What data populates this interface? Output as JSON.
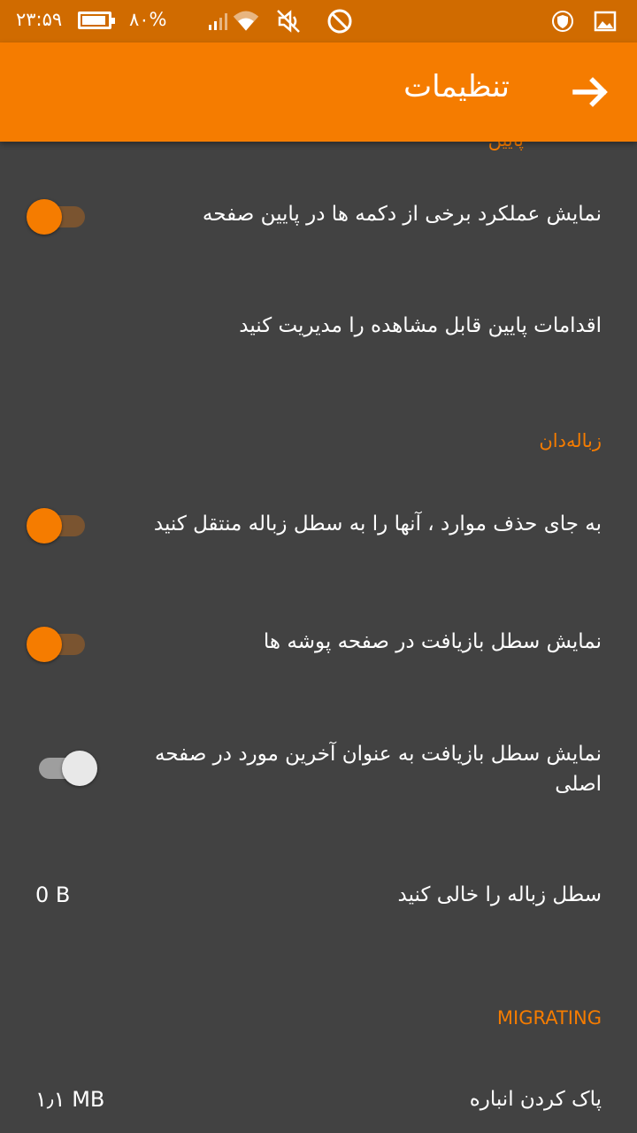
{
  "status_bar": {
    "time": "۲۳:۵۹",
    "battery_percent": "۸۰%",
    "battery_level": 0.8,
    "icons": [
      "battery-icon",
      "signal-icon",
      "wifi-icon",
      "mute-icon",
      "do-not-disturb-icon",
      "vpn-shield-icon",
      "gallery-icon"
    ]
  },
  "app_bar": {
    "title": "تنظیمات",
    "back_icon": "arrow-forward-icon"
  },
  "colors": {
    "accent": "#f57c00",
    "status_bar": "#d06b00",
    "background": "#424242"
  },
  "sections": [
    {
      "header": "پایین",
      "items": [
        {
          "title": "نمایش عملکرد برخی از دکمه ها در پایین صفحه",
          "switch_on": true
        },
        {
          "title": "اقدامات پایین قابل مشاهده را مدیریت کنید"
        }
      ]
    },
    {
      "header": "زباله‌دان",
      "items": [
        {
          "title": "به جای حذف موارد ، آنها را به سطل زباله منتقل کنید",
          "switch_on": true
        },
        {
          "title": "نمایش سطل بازیافت در صفحه پوشه ها",
          "switch_on": true
        },
        {
          "title": "نمایش سطل بازیافت به عنوان آخرین مورد در صفحه اصلی",
          "switch_on": false
        },
        {
          "title": "سطل زباله را خالی کنید",
          "summary": "0 B"
        }
      ]
    },
    {
      "header": "MIGRATING",
      "items": [
        {
          "title": "پاک کردن انباره",
          "summary": "۱٫۱ MB"
        }
      ]
    }
  ]
}
